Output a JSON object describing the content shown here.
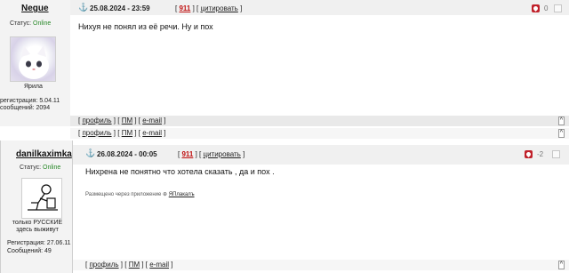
{
  "post1": {
    "nick": "Negue",
    "status_label": "Статус:",
    "status_value": "Online",
    "avatar_caption": "Ярила",
    "reg_line": "регистрация: 5.04.11",
    "msgs_line": "сообщений: 2094",
    "date": "25.08.2024 - 23:59",
    "post_num": "911",
    "quote_label": "цитировать",
    "message": "Нихуя не понял из её речи. Ну и пох",
    "vote_count": "0",
    "profile_label": "профиль",
    "pm_label": "ПМ",
    "email_label": "e-mail",
    "up_label": "^"
  },
  "post2": {
    "nick": "danilkaximka",
    "status_label": "Статус:",
    "status_value": "Online",
    "avatar_caption": "только РУССКИЕ здесь выживут",
    "reg_line": "Регистрация: 27.06.11",
    "msgs_line": "Сообщений: 49",
    "date": "26.08.2024 - 00:05",
    "post_num": "911",
    "quote_label": "цитировать",
    "message": "Нихрена не понятно что хотела сказать , да и пох .",
    "note_prefix": "Размещено через приложение",
    "note_app": "ЯПлакалъ",
    "vote_count": "-2",
    "profile_label": "профиль",
    "pm_label": "ПМ",
    "email_label": "e-mail",
    "up_label": "^"
  },
  "icons": [
    "anchor-icon",
    "vote-icon",
    "up-arrow-icon"
  ]
}
